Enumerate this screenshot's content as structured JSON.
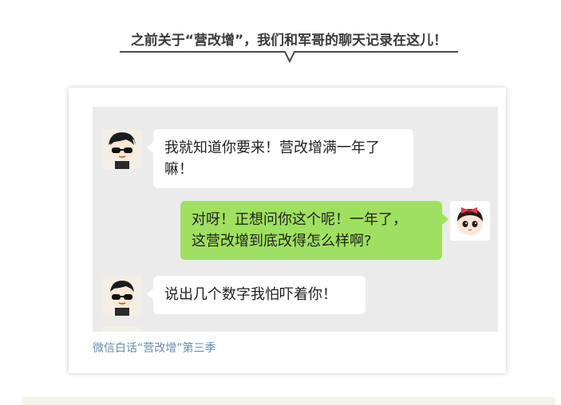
{
  "header": {
    "title": "之前关于“营改增”，我们和军哥的聊天记录在这儿！"
  },
  "chat": {
    "messages": [
      {
        "side": "left",
        "text_line1": "我就知道你要来！营改增满一年了",
        "text_line2": "嘛！"
      },
      {
        "side": "right",
        "text_line1": "对呀！正想问你这个呢！一年了，",
        "text_line2": "这营改增到底改得怎么样啊?"
      },
      {
        "side": "left",
        "text_line1": "说出几个数字我怕吓着你！"
      }
    ]
  },
  "caption": {
    "text": "微信白话“营改增”第三季"
  },
  "colors": {
    "chat_background": "#ebebeb",
    "left_bubble": "#ffffff",
    "right_bubble": "#9fe060",
    "caption": "#6a8aa6",
    "heading_text": "#3b3b3b"
  },
  "icons": {
    "left_avatar": "avatar-boy-sunglasses-icon",
    "right_avatar": "avatar-girl-bow-icon"
  }
}
